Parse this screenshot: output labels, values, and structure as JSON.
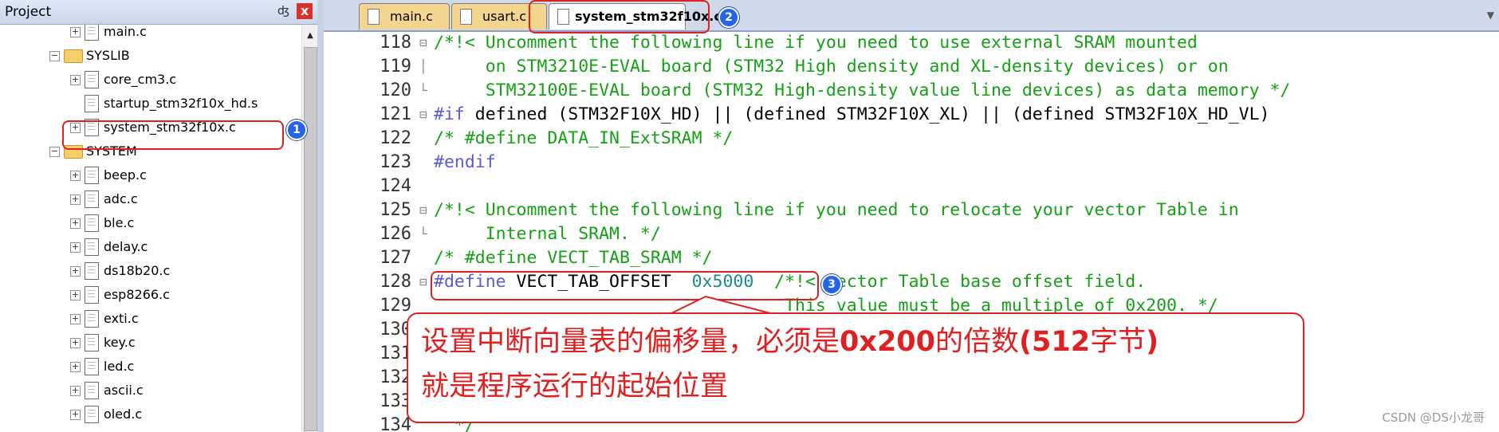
{
  "project_pane": {
    "title": "Project",
    "pin_glyph": "ᵦ",
    "close_glyph": "x",
    "tree": [
      {
        "type": "file",
        "label": "main.c",
        "indent": 2,
        "expandable": true
      },
      {
        "type": "folder",
        "label": "SYSLIB",
        "indent": 1,
        "expandable": true
      },
      {
        "type": "file",
        "label": "core_cm3.c",
        "indent": 2,
        "expandable": true
      },
      {
        "type": "file",
        "label": "startup_stm32f10x_hd.s",
        "indent": 2,
        "expandable": false
      },
      {
        "type": "file",
        "label": "system_stm32f10x.c",
        "indent": 2,
        "expandable": true
      },
      {
        "type": "folder",
        "label": "SYSTEM",
        "indent": 1,
        "expandable": true
      },
      {
        "type": "file",
        "label": "beep.c",
        "indent": 2,
        "expandable": true
      },
      {
        "type": "file",
        "label": "adc.c",
        "indent": 2,
        "expandable": true
      },
      {
        "type": "file",
        "label": "ble.c",
        "indent": 2,
        "expandable": true
      },
      {
        "type": "file",
        "label": "delay.c",
        "indent": 2,
        "expandable": true
      },
      {
        "type": "file",
        "label": "ds18b20.c",
        "indent": 2,
        "expandable": true
      },
      {
        "type": "file",
        "label": "esp8266.c",
        "indent": 2,
        "expandable": true
      },
      {
        "type": "file",
        "label": "exti.c",
        "indent": 2,
        "expandable": true
      },
      {
        "type": "file",
        "label": "key.c",
        "indent": 2,
        "expandable": true
      },
      {
        "type": "file",
        "label": "led.c",
        "indent": 2,
        "expandable": true
      },
      {
        "type": "file",
        "label": "ascii.c",
        "indent": 2,
        "expandable": true
      },
      {
        "type": "file",
        "label": "oled.c",
        "indent": 2,
        "expandable": true
      }
    ]
  },
  "tabs": [
    {
      "label": "main.c",
      "active": false
    },
    {
      "label": "usart.c",
      "active": false
    },
    {
      "label": "system_stm32f10x.c",
      "active": true
    }
  ],
  "editor": {
    "lines": [
      {
        "num": "118",
        "fold": "⊟",
        "parts": [
          [
            "comment",
            "/*!< Uncomment the following line if you need to use external SRAM mounted"
          ]
        ]
      },
      {
        "num": "119",
        "fold": "│",
        "parts": [
          [
            "comment",
            "     on STM3210E-EVAL board (STM32 High density and XL-density devices) or on"
          ]
        ]
      },
      {
        "num": "120",
        "fold": "└",
        "parts": [
          [
            "comment",
            "     STM32100E-EVAL board (STM32 High-density value line devices) as data memory */"
          ]
        ]
      },
      {
        "num": "121",
        "fold": "⊟",
        "parts": [
          [
            "pre",
            "#if"
          ],
          [
            "text",
            " defined (STM32F10X_HD) || (defined STM32F10X_XL) || (defined STM32F10X_HD_VL)"
          ]
        ]
      },
      {
        "num": "122",
        "fold": "",
        "parts": [
          [
            "comment",
            "/* #define DATA_IN_ExtSRAM */"
          ]
        ]
      },
      {
        "num": "123",
        "fold": "",
        "parts": [
          [
            "pre",
            "#endif"
          ]
        ]
      },
      {
        "num": "124",
        "fold": "",
        "parts": []
      },
      {
        "num": "125",
        "fold": "⊟",
        "parts": [
          [
            "comment",
            "/*!< Uncomment the following line if you need to relocate your vector Table in"
          ]
        ]
      },
      {
        "num": "126",
        "fold": "└",
        "parts": [
          [
            "comment",
            "     Internal SRAM. */"
          ]
        ]
      },
      {
        "num": "127",
        "fold": "",
        "parts": [
          [
            "comment",
            "/* #define VECT_TAB_SRAM */"
          ]
        ]
      },
      {
        "num": "128",
        "fold": "⊟",
        "parts": [
          [
            "pre",
            "#define"
          ],
          [
            "text",
            " VECT_TAB_OFFSET  "
          ],
          [
            "num",
            "0x5000"
          ],
          [
            "comment",
            "  /*!< Vector Table base offset field."
          ]
        ]
      },
      {
        "num": "129",
        "fold": "",
        "parts": [
          [
            "comment",
            "                                  This value must be a multiple of 0x200. */"
          ]
        ]
      },
      {
        "num": "130",
        "fold": "",
        "parts": []
      },
      {
        "num": "131",
        "fold": "",
        "parts": []
      },
      {
        "num": "132",
        "fold": "",
        "parts": []
      },
      {
        "num": "133",
        "fold": "",
        "parts": []
      },
      {
        "num": "134",
        "fold": "",
        "parts": [
          [
            "comment",
            "  */"
          ]
        ]
      }
    ]
  },
  "annotations": {
    "badge1": "1",
    "badge2": "2",
    "badge3": "3",
    "callout_line1_a": "设置中断向量表的偏移量，必须是",
    "callout_line1_b": "0x200",
    "callout_line1_c": "的倍数",
    "callout_line1_d": "(512",
    "callout_line1_e": "字节",
    "callout_line1_f": ")",
    "callout_line2": "就是程序运行的起始位置"
  },
  "watermark": "CSDN @DS小龙哥",
  "colors": {
    "comment": "#15a015",
    "preprocessor": "#5b5bd6",
    "annotation_red": "#e02020",
    "badge_blue": "#2563eb"
  }
}
